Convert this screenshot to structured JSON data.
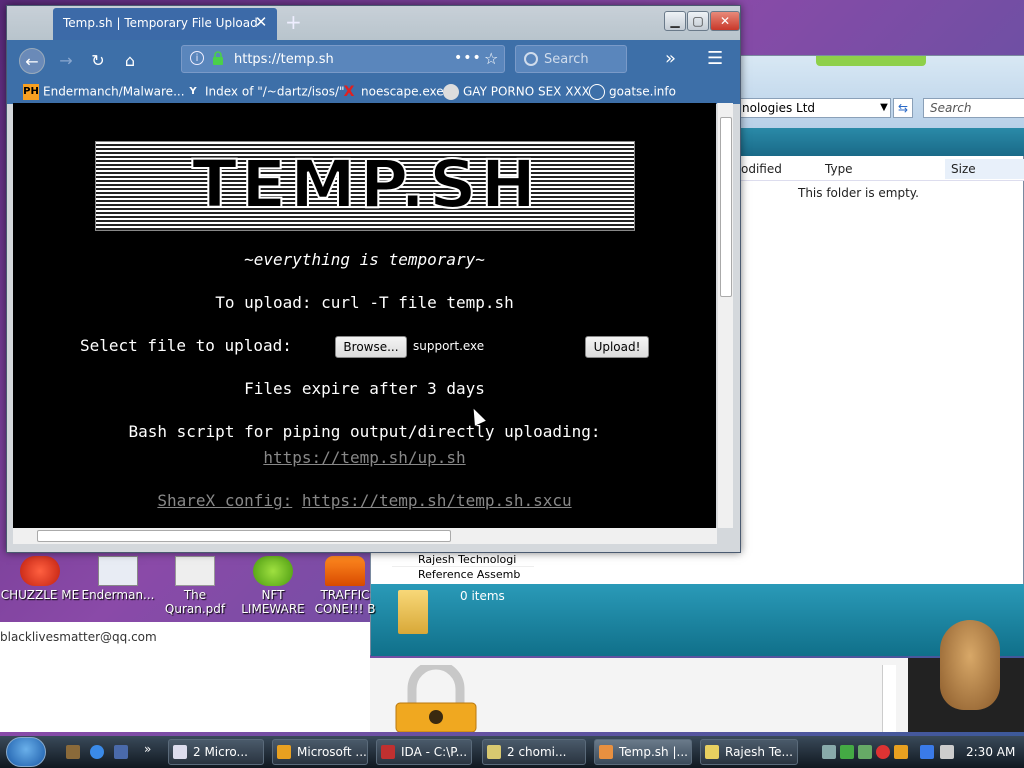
{
  "explorer": {
    "path": "nologies Ltd",
    "search_placeholder": "Search",
    "columns": {
      "modified": "odified",
      "type": "Type",
      "size": "Size"
    },
    "empty_message": "This folder is empty.",
    "status_items": "0 items",
    "tree_item_1": "Rajesh Technologi",
    "tree_item_2": "Reference Assemb"
  },
  "lower_panel": {
    "email": "blacklivesmatter@qq.com"
  },
  "desktop_icons": [
    {
      "label": "CHUZZLE ME"
    },
    {
      "label": "Enderman..."
    },
    {
      "label": "The Quran.pdf"
    },
    {
      "label": "NFT LIMEWARE"
    },
    {
      "label": "TRAFFIC CONE!!! B"
    }
  ],
  "firefox": {
    "tab_title": "Temp.sh | Temporary File Upload",
    "url": "https://temp.sh",
    "search_placeholder": "Search",
    "bookmarks": [
      {
        "label": "Endermanch/Malware...",
        "icon": "PH"
      },
      {
        "label": "Index of \"/~dartz/isos/\"",
        "icon": "Y"
      },
      {
        "label": "noescape.exe",
        "icon": "X"
      },
      {
        "label": "GAY PORNO SEX XXX",
        "icon": "mask"
      },
      {
        "label": "goatse.info",
        "icon": "globe"
      }
    ]
  },
  "page": {
    "banner": "TEMP.SH",
    "tagline": "~everything is temporary~",
    "curl_instruction": "To upload: curl -T file temp.sh",
    "select_label": "Select file to upload:",
    "browse_label": "Browse...",
    "selected_file": "support.exe",
    "upload_label": "Upload!",
    "expire_text": "Files expire after 3 days",
    "bash_text": "Bash script for piping output/directly uploading:",
    "bash_link": "https://temp.sh/up.sh",
    "sharex_label": "ShareX config:",
    "sharex_link": "https://temp.sh/temp.sh.sxcu"
  },
  "taskbar": {
    "items": [
      {
        "label": "2 Micro..."
      },
      {
        "label": "Microsoft ..."
      },
      {
        "label": "IDA - C:\\P..."
      },
      {
        "label": "2 chomi..."
      },
      {
        "label": "Temp.sh |..."
      },
      {
        "label": "Rajesh Te..."
      }
    ],
    "clock": "2:30 AM"
  }
}
